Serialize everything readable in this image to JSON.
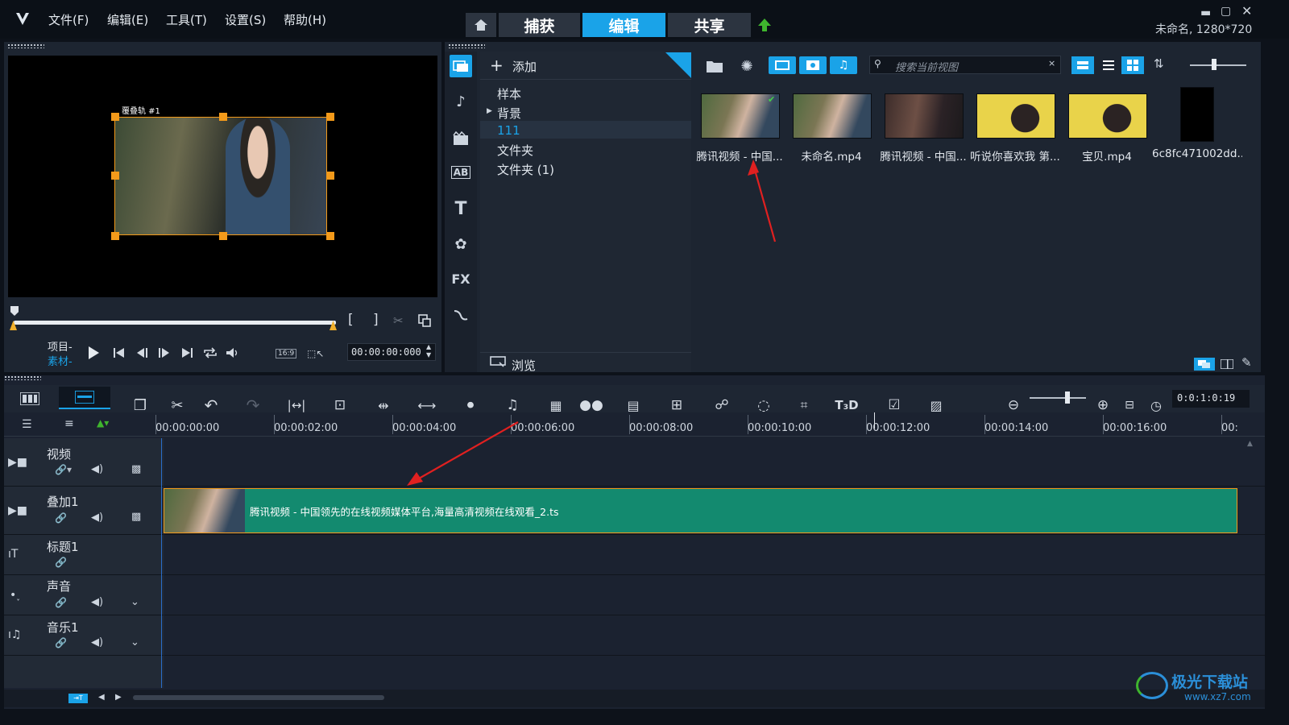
{
  "menu": [
    "文件(F)",
    "编辑(E)",
    "工具(T)",
    "设置(S)",
    "帮助(H)"
  ],
  "tabs": {
    "capture": "捕获",
    "edit": "编辑",
    "share": "共享"
  },
  "project_info": "未命名, 1280*720",
  "preview": {
    "overlay_label": "覆叠轨 #1",
    "mode_project": "项目-",
    "mode_clip": "素材-",
    "aspect": "16:9",
    "timecode": "00:00:00:000"
  },
  "library": {
    "add_label": "添加",
    "folders": [
      "样本",
      "背景",
      "111",
      "文件夹",
      "文件夹 (1)"
    ],
    "selected_folder": "111",
    "browse_label": "浏览",
    "search_placeholder": "搜索当前视图",
    "items": [
      {
        "label": "腾讯视频 - 中国...",
        "checked": true
      },
      {
        "label": "未命名.mp4",
        "checked": false
      },
      {
        "label": "腾讯视频 - 中国...",
        "checked": false
      },
      {
        "label": "听说你喜欢我 第...",
        "checked": false
      },
      {
        "label": "宝贝.mp4",
        "checked": false
      },
      {
        "label": "6c8fc471002dd...",
        "checked": false
      }
    ]
  },
  "timeline": {
    "zoom_timecode": "0:0:1:0:19",
    "ruler": [
      "00:00:00:00",
      "00:00:02:00",
      "00:00:04:00",
      "00:00:06:00",
      "00:00:08:00",
      "00:00:10:00",
      "00:00:12:00",
      "00:00:14:00",
      "00:00:16:00",
      "00:"
    ],
    "tracks": [
      "视频",
      "叠加1",
      "标题1",
      "声音",
      "音乐1"
    ],
    "clip_title": "腾讯视频 - 中国领先的在线视频媒体平台,海量高清视频在线观看_2.ts"
  },
  "watermark": {
    "name": "极光下载站",
    "url": "www.xz7.com"
  },
  "colors": {
    "accent": "#1aa3e8",
    "clip": "#138a6f",
    "handle": "#f39a1a",
    "arrow": "#e02020"
  }
}
